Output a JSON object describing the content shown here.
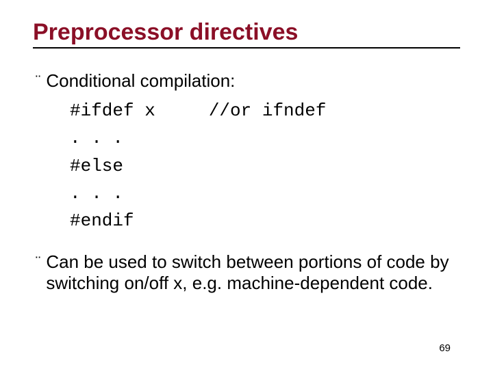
{
  "title": "Preprocessor directives",
  "bullets": {
    "b1": "Conditional compilation:",
    "b2": "Can be used to switch between portions of code by switching on/off x, e.g. machine-dependent code."
  },
  "code": {
    "line1": "#ifdef x     //or ifndef",
    "line2": ". . .",
    "line3": "#else",
    "line4": ". . .",
    "line5": "#endif"
  },
  "bulletGlyph": "¨",
  "pageNumber": "69"
}
